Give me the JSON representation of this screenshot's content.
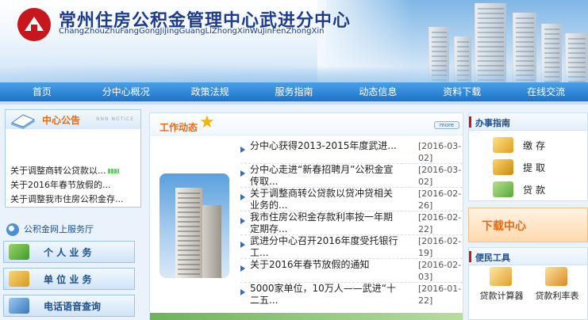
{
  "header": {
    "title": "常州住房公积金管理中心武进分中心",
    "subtitle": "ChangZhouZhuFangGongJiJingGuangLiZhongXinWuJinFenZhongXin"
  },
  "nav": [
    {
      "label": "首页"
    },
    {
      "label": "分中心概况"
    },
    {
      "label": "政策法规"
    },
    {
      "label": "服务指南"
    },
    {
      "label": "动态信息"
    },
    {
      "label": "资料下载"
    },
    {
      "label": "在线交流"
    }
  ],
  "notice": {
    "title": "中心公告",
    "tag": "NNN NOTICE",
    "items": [
      {
        "text": "关于调整商转公贷款以..."
      },
      {
        "text": "关于2016年春节放假的..."
      },
      {
        "text": "关于调整我市住房公积金存..."
      }
    ]
  },
  "services": {
    "title": "公积金网上服务厅",
    "buttons": [
      {
        "label": "个 人 业 务"
      },
      {
        "label": "单 位 业 务"
      },
      {
        "label": "电话语音查询"
      }
    ]
  },
  "work": {
    "title": "工作动态",
    "more": "more",
    "news": [
      {
        "title": "分中心获得2013-2015年度武进...",
        "date": "[2016-03-02]"
      },
      {
        "title": "分中心走进“新春招聘月”公积金宣传取...",
        "date": "[2016-03-02]"
      },
      {
        "title": "关于调整商转公贷款以贷冲贷相关业务的...",
        "date": "[2016-02-26]"
      },
      {
        "title": "我市住房公积金存款利率按一年期定期存...",
        "date": "[2016-02-22]"
      },
      {
        "title": "武进分中心召开2016年度受托银行工...",
        "date": "[2016-02-19]"
      },
      {
        "title": "关于2016年春节放假的通知",
        "date": "[2016-02-03]"
      },
      {
        "title": "5000家单位，10万人——武进“十二五...",
        "date": "[2016-01-22]"
      }
    ]
  },
  "guide": {
    "title": "办事指南",
    "items": [
      {
        "label": "缴存"
      },
      {
        "label": "提取"
      },
      {
        "label": "贷款"
      }
    ]
  },
  "download": {
    "label": "下载中心"
  },
  "tools": {
    "title": "便民工具",
    "items": [
      {
        "label": "贷款计算器"
      },
      {
        "label": "贷款利率表"
      }
    ]
  },
  "colors": {
    "nav_blue": "#1c73c9",
    "accent_orange": "#e86a10",
    "title_blue": "#1d3c8f",
    "logo_red": "#c8161d"
  }
}
